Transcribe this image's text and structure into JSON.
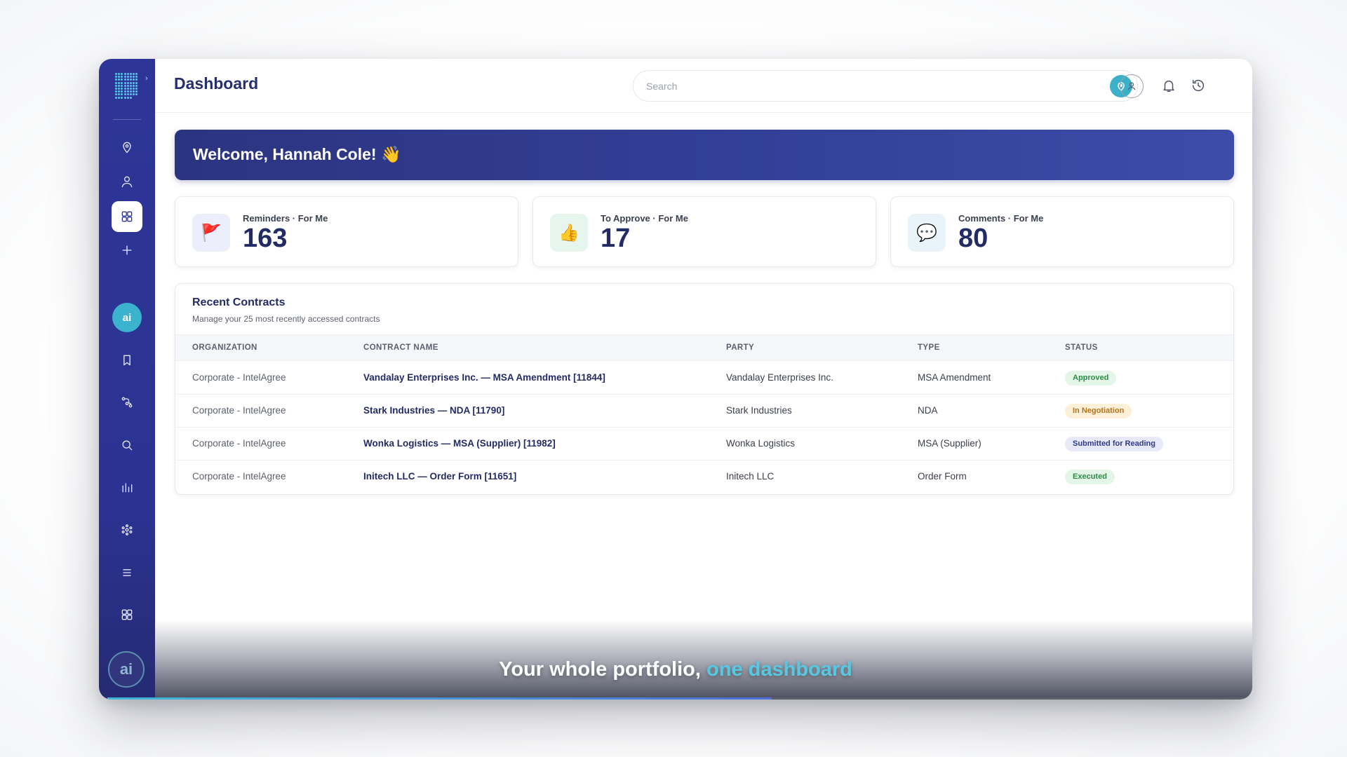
{
  "header": {
    "title": "Dashboard",
    "search_placeholder": "Search"
  },
  "sidebar": {
    "items": [
      {
        "name": "location-pin-icon"
      },
      {
        "name": "user-icon"
      },
      {
        "name": "dashboard-grid-icon",
        "active": true
      },
      {
        "name": "plus-icon"
      },
      {
        "name": "ai-assistant",
        "label": "ai"
      },
      {
        "name": "bookmark-icon"
      },
      {
        "name": "workflow-icon"
      },
      {
        "name": "search-icon"
      },
      {
        "name": "bar-chart-icon"
      },
      {
        "name": "network-icon"
      },
      {
        "name": "list-icon"
      },
      {
        "name": "apps-grid-icon"
      }
    ],
    "bottom_ai_label": "ai"
  },
  "banner": {
    "welcome": "Welcome, Hannah Cole! 👋"
  },
  "stats": [
    {
      "label": "Reminders · For Me",
      "value": "163",
      "icon": "flag-icon",
      "icon_glyph": "🚩",
      "icon_bg": "#eceefb"
    },
    {
      "label": "To Approve · For Me",
      "value": "17",
      "icon": "thumbs-up-icon",
      "icon_glyph": "👍",
      "icon_bg": "#e6f6ee"
    },
    {
      "label": "Comments · For Me",
      "value": "80",
      "icon": "comment-icon",
      "icon_glyph": "💬",
      "icon_bg": "#e8f4fa"
    }
  ],
  "recent_contracts": {
    "title": "Recent Contracts",
    "subtitle": "Manage your 25 most recently accessed contracts",
    "columns": [
      "ORGANIZATION",
      "CONTRACT NAME",
      "PARTY",
      "TYPE",
      "STATUS"
    ],
    "rows": [
      {
        "organization": "Corporate - IntelAgree",
        "contract_name": "Vandalay Enterprises Inc. — MSA Amendment [11844]",
        "party": "Vandalay Enterprises Inc.",
        "type": "MSA Amendment",
        "status": "Approved"
      },
      {
        "organization": "Corporate - IntelAgree",
        "contract_name": "Stark Industries — NDA [11790]",
        "party": "Stark Industries",
        "type": "NDA",
        "status": "In Negotiation"
      },
      {
        "organization": "Corporate - IntelAgree",
        "contract_name": "Wonka Logistics — MSA (Supplier) [11982]",
        "party": "Wonka Logistics",
        "type": "MSA (Supplier)",
        "status": "Submitted for Reading"
      },
      {
        "organization": "Corporate - IntelAgree",
        "contract_name": "Initech LLC — Order Form [11651]",
        "party": "Initech LLC",
        "type": "Order Form",
        "status": "Executed"
      }
    ]
  },
  "caption": {
    "main": "Your whole portfolio, ",
    "accent": "one dashboard"
  },
  "progress": {
    "fraction": 0.58
  },
  "colors": {
    "sidebar": "#2d3696",
    "accent": "#3ab1c9",
    "brand_dark": "#232b66"
  }
}
